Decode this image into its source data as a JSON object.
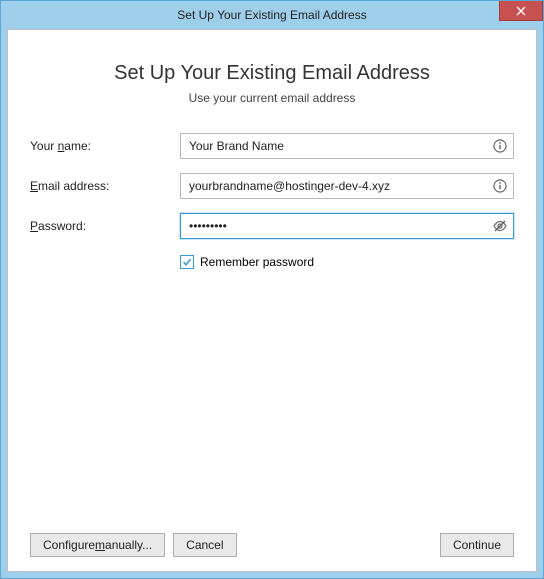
{
  "window": {
    "title": "Set Up Your Existing Email Address"
  },
  "header": {
    "heading": "Set Up Your Existing Email Address",
    "subheading": "Use your current email address"
  },
  "form": {
    "name": {
      "label_pre": "Your ",
      "label_ul": "n",
      "label_post": "ame:",
      "value": "Your Brand Name"
    },
    "email": {
      "label_ul": "E",
      "label_post": "mail address:",
      "value": "yourbrandname@hostinger-dev-4.xyz"
    },
    "password": {
      "label_ul": "P",
      "label_post": "assword:",
      "value": "•••••••••"
    },
    "remember": {
      "label_pre": "Re",
      "label_ul": "m",
      "label_post": "ember password",
      "checked": true
    }
  },
  "buttons": {
    "configure_pre": "Configure ",
    "configure_ul": "m",
    "configure_post": "anually...",
    "cancel": "Cancel",
    "continue": "Continue"
  }
}
